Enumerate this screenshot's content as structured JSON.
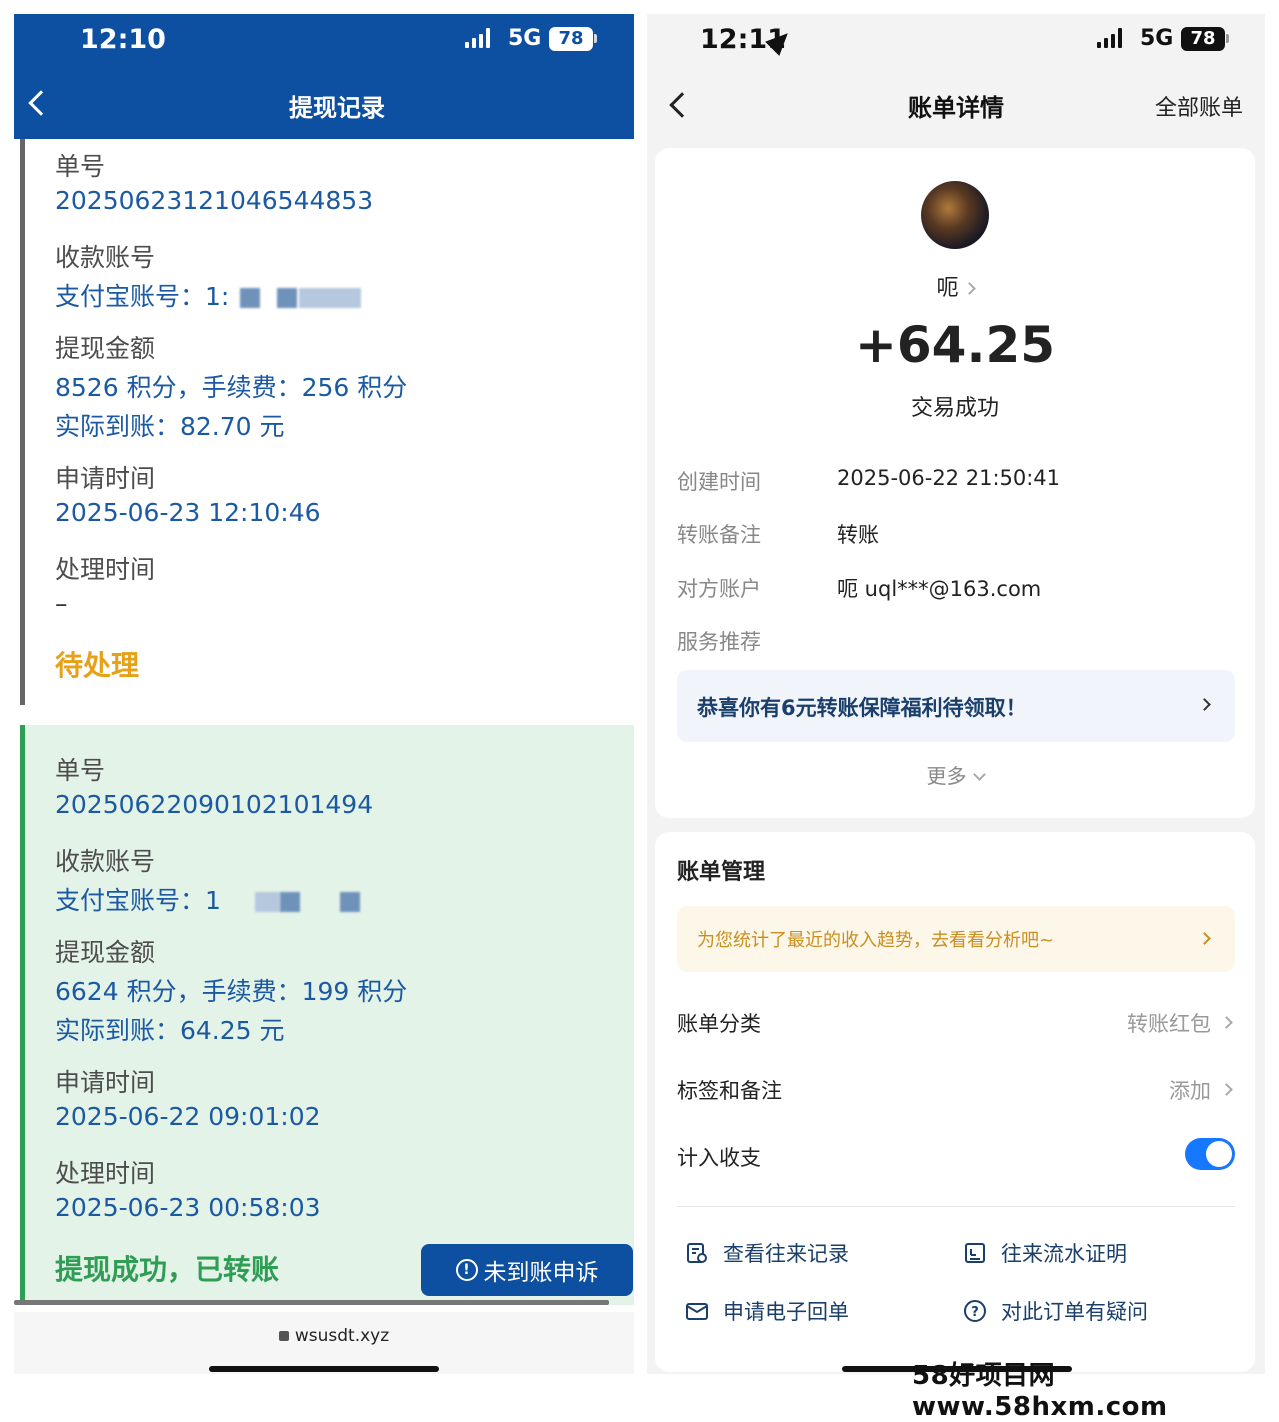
{
  "left": {
    "status_bar": {
      "time": "12:10",
      "network": "5G",
      "battery": "78"
    },
    "header": {
      "title": "提现记录"
    },
    "records": [
      {
        "order_label": "单号",
        "order_no": "20250623121046544853",
        "account_label": "收款账号",
        "account_value": "支付宝账号：1:",
        "amount_label": "提现金额",
        "amount_value": "8526 积分，手续费：256 积分",
        "actual_value": "实际到账：82.70 元",
        "apply_label": "申请时间",
        "apply_time": "2025-06-23 12:10:46",
        "process_label": "处理时间",
        "process_time": "–",
        "status": "待处理",
        "status_color": "#e8a017"
      },
      {
        "order_label": "单号",
        "order_no": "20250622090102101494",
        "account_label": "收款账号",
        "account_value": "支付宝账号：1",
        "amount_label": "提现金额",
        "amount_value": "6624 积分，手续费：199 积分",
        "actual_value": "实际到账：64.25 元",
        "apply_label": "申请时间",
        "apply_time": "2025-06-22 09:01:02",
        "process_label": "处理时间",
        "process_time": "2025-06-23 00:58:03",
        "status": "提现成功，已转账",
        "status_color": "#2f9e55"
      }
    ],
    "appeal_button": "未到账申诉",
    "url": "wsusdt.xyz"
  },
  "right": {
    "status_bar": {
      "time": "12:11",
      "network": "5G",
      "battery": "78"
    },
    "header": {
      "title": "账单详情",
      "action": "全部账单"
    },
    "payer_name": "呃",
    "amount": "+64.25",
    "tx_status": "交易成功",
    "details": [
      {
        "label": "创建时间",
        "value": "2025-06-22 21:50:41"
      },
      {
        "label": "转账备注",
        "value": "转账"
      },
      {
        "label": "对方账户",
        "value": "呃 uql***@163.com"
      },
      {
        "label": "服务推荐",
        "value": ""
      }
    ],
    "promo": "恭喜你有6元转账保障福利待领取！",
    "more": "更多",
    "bill_management": {
      "title": "账单管理",
      "tip": "为您统计了最近的收入趋势，去看看分析吧~",
      "category_label": "账单分类",
      "category_value": "转账红包",
      "tags_label": "标签和备注",
      "tags_value": "添加",
      "count_label": "计入收支",
      "count_enabled": true
    },
    "actions": [
      {
        "label": "查看往来记录",
        "icon": "record-icon"
      },
      {
        "label": "往来流水证明",
        "icon": "certificate-icon"
      },
      {
        "label": "申请电子回单",
        "icon": "mail-icon"
      },
      {
        "label": "对此订单有疑问",
        "icon": "question-icon"
      }
    ]
  },
  "watermark": "58好项目网www.58hxm.com",
  "colors": {
    "header_blue": "#0d4fa0",
    "link_blue": "#1b5aa3",
    "success_green": "#2f9e55",
    "toggle_blue": "#1677ff"
  }
}
